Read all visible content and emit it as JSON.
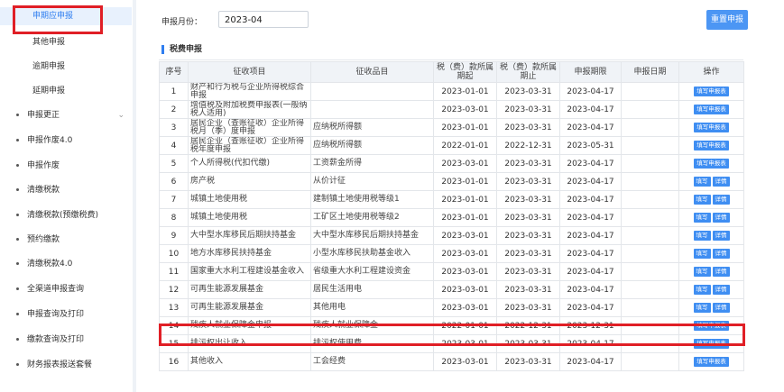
{
  "sidebar": {
    "items": [
      {
        "label": "申期应申报",
        "level": "sub",
        "active": true
      },
      {
        "label": "其他申报",
        "level": "sub"
      },
      {
        "label": "逾期申报",
        "level": "sub"
      },
      {
        "label": "延期申报",
        "level": "sub"
      },
      {
        "label": "申报更正",
        "level": "top",
        "expandable": true
      },
      {
        "label": "申报作废4.0",
        "level": "top"
      },
      {
        "label": "申报作废",
        "level": "top"
      },
      {
        "label": "清缴税款",
        "level": "top"
      },
      {
        "label": "清缴税款(预缴税费)",
        "level": "top"
      },
      {
        "label": "预约缴款",
        "level": "top"
      },
      {
        "label": "清缴税款4.0",
        "level": "top"
      },
      {
        "label": "全渠道申报查询",
        "level": "top"
      },
      {
        "label": "申报查询及打印",
        "level": "top"
      },
      {
        "label": "缴款查询及打印",
        "level": "top"
      },
      {
        "label": "财务报表报送套餐",
        "level": "top"
      }
    ],
    "chevron": "⌄"
  },
  "header": {
    "period_label": "申报月份：",
    "period_value": "2023-04",
    "reset_button": "重置申报"
  },
  "section": {
    "title": "税费申报"
  },
  "table": {
    "columns": [
      "序号",
      "征收项目",
      "征收品目",
      "税（费）款所属期起",
      "税（费）款所属期止",
      "申报期限",
      "申报日期",
      "操作"
    ],
    "rows": [
      {
        "seq": "1",
        "item": "财产和行为税与企业所得税综合申报",
        "name": "",
        "start": "2023-01-01",
        "end": "2023-03-31",
        "deadline": "2023-04-17",
        "date": "",
        "ops": [
          "填写申报表"
        ]
      },
      {
        "seq": "2",
        "item": "增值税及附加税费申报表(一般纳税人适用)",
        "name": "",
        "start": "2023-03-01",
        "end": "2023-03-31",
        "deadline": "2023-04-17",
        "date": "",
        "ops": [
          "填写申报表"
        ]
      },
      {
        "seq": "3",
        "item": "居民企业（查账征收）企业所得税月（季）度申报",
        "name": "应纳税所得额",
        "start": "2023-01-01",
        "end": "2023-03-31",
        "deadline": "2023-04-17",
        "date": "",
        "ops": [
          "填写申报表"
        ]
      },
      {
        "seq": "4",
        "item": "居民企业（查账征收）企业所得税年度申报",
        "name": "应纳税所得额",
        "start": "2022-01-01",
        "end": "2022-12-31",
        "deadline": "2023-05-31",
        "date": "",
        "ops": [
          "填写申报表"
        ]
      },
      {
        "seq": "5",
        "item": "个人所得税(代扣代缴)",
        "name": "工资薪金所得",
        "start": "2023-03-01",
        "end": "2023-03-31",
        "deadline": "2023-04-17",
        "date": "",
        "ops": [
          "填写申报表"
        ]
      },
      {
        "seq": "6",
        "item": "房产税",
        "name": "从价计征",
        "start": "2023-01-01",
        "end": "2023-03-31",
        "deadline": "2023-04-17",
        "date": "",
        "ops": [
          "填写",
          "详情"
        ]
      },
      {
        "seq": "7",
        "item": "城镇土地使用税",
        "name": "建制镇土地使用税等级1",
        "start": "2023-01-01",
        "end": "2023-03-31",
        "deadline": "2023-04-17",
        "date": "",
        "ops": [
          "填写",
          "详情"
        ]
      },
      {
        "seq": "8",
        "item": "城镇土地使用税",
        "name": "工矿区土地使用税等级2",
        "start": "2023-01-01",
        "end": "2023-03-31",
        "deadline": "2023-04-17",
        "date": "",
        "ops": [
          "填写",
          "详情"
        ]
      },
      {
        "seq": "9",
        "item": "大中型水库移民后期扶持基金",
        "name": "大中型水库移民后期扶持基金",
        "start": "2023-03-01",
        "end": "2023-03-31",
        "deadline": "2023-04-17",
        "date": "",
        "ops": [
          "填写",
          "详情"
        ]
      },
      {
        "seq": "10",
        "item": "地方水库移民扶持基金",
        "name": "小型水库移民扶助基金收入",
        "start": "2023-03-01",
        "end": "2023-03-31",
        "deadline": "2023-04-17",
        "date": "",
        "ops": [
          "填写",
          "详情"
        ]
      },
      {
        "seq": "11",
        "item": "国家重大水利工程建设基金收入",
        "name": "省级重大水利工程建设资金",
        "start": "2023-03-01",
        "end": "2023-03-31",
        "deadline": "2023-04-17",
        "date": "",
        "ops": [
          "填写",
          "详情"
        ]
      },
      {
        "seq": "12",
        "item": "可再生能源发展基金",
        "name": "居民生活用电",
        "start": "2023-03-01",
        "end": "2023-03-31",
        "deadline": "2023-04-17",
        "date": "",
        "ops": [
          "填写",
          "详情"
        ]
      },
      {
        "seq": "13",
        "item": "可再生能源发展基金",
        "name": "其他用电",
        "start": "2023-03-01",
        "end": "2023-03-31",
        "deadline": "2023-04-17",
        "date": "",
        "ops": [
          "填写",
          "详情"
        ]
      },
      {
        "seq": "14",
        "item": "残疾人就业保障金申报",
        "name": "残疾人就业保障金",
        "start": "2022-01-01",
        "end": "2022-12-31",
        "deadline": "2023-12-31",
        "date": "",
        "ops": [
          "填写申报表"
        ]
      },
      {
        "seq": "15",
        "item": "排污权出让收入",
        "name": "排污权使用费",
        "start": "2023-03-01",
        "end": "2023-03-31",
        "deadline": "2023-04-17",
        "date": "",
        "ops": [
          "填写申报表"
        ]
      },
      {
        "seq": "16",
        "item": "其他收入",
        "name": "工会经费",
        "start": "2023-03-01",
        "end": "2023-03-31",
        "deadline": "2023-04-17",
        "date": "",
        "ops": [
          "填写申报表"
        ]
      }
    ]
  },
  "colors": {
    "accent": "#2f7ef0",
    "button": "#3f8ef2",
    "highlight": "#e01f26",
    "header_bg": "#f0f3f7"
  }
}
